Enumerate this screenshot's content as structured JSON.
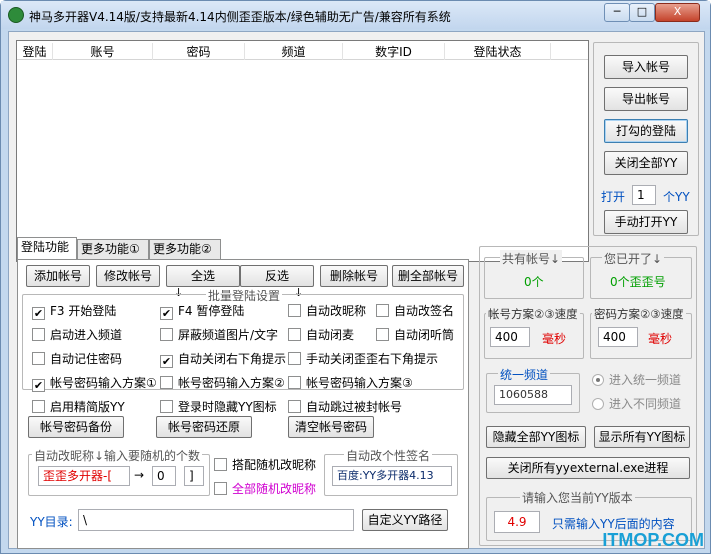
{
  "window": {
    "title": "神马多开器V4.14版/支持最新4.14内侧歪歪版本/绿色辅助无广告/兼容所有系统",
    "minimize": "─",
    "maximize": "□",
    "close": "X"
  },
  "account_list": {
    "columns": [
      "登陆",
      "账号",
      "密码",
      "频道",
      "数字ID",
      "登陆状态"
    ]
  },
  "right_panel": {
    "import": "导入帐号",
    "export": "导出帐号",
    "login_checked": "打勾的登陆",
    "close_all": "关闭全部YY",
    "open_prefix": "打开",
    "open_count": "1",
    "open_suffix": "个YY",
    "manual_open": "手动打开YY"
  },
  "tabs": [
    "登陆功能",
    "更多功能①",
    "更多功能②"
  ],
  "tab_panel": {
    "add": "添加帐号",
    "edit": "修改帐号",
    "select_all": "全选",
    "invert": "反选",
    "delete": "删除帐号",
    "delete_all": "删全部帐号",
    "batch_group": "批量登陆设置",
    "checks": [
      {
        "label": "F3 开始登陆",
        "checked": true
      },
      {
        "label": "F4 暂停登陆",
        "checked": true
      },
      {
        "label": "自动改昵称",
        "checked": false
      },
      {
        "label": "自动改签名",
        "checked": false
      },
      {
        "label": "启动进入频道",
        "checked": false
      },
      {
        "label": "屏蔽频道图片/文字",
        "checked": false
      },
      {
        "label": "自动闭麦",
        "checked": false
      },
      {
        "label": "自动闭听筒",
        "checked": false
      },
      {
        "label": "自动记住密码",
        "checked": false
      },
      {
        "label": "自动关闭右下角提示",
        "checked": true
      },
      {
        "label": "手动关闭歪歪右下角提示",
        "checked": false
      },
      {
        "label": "帐号密码输入方案①",
        "checked": true
      },
      {
        "label": "帐号密码输入方案②",
        "checked": false
      },
      {
        "label": "帐号密码输入方案③",
        "checked": false
      },
      {
        "label": "启用精简版YY",
        "checked": false
      },
      {
        "label": "登录时隐藏YY图标",
        "checked": false
      },
      {
        "label": "自动跳过被封帐号",
        "checked": false
      }
    ],
    "backup": "帐号密码备份",
    "restore": "帐号密码还原",
    "clear": "清空帐号密码",
    "nick_group": "自动改昵称↓输入要随机的个数",
    "nick_value": "歪歪多开器-[",
    "arrow": "→",
    "nick_count": "0",
    "nick_bracket": "]",
    "random_mix": "搭配随机改昵称",
    "all_random": "全部随机改昵称",
    "sign_group": "自动改个性签名",
    "sign_value": "百度:YY多开器4.13",
    "yy_dir_label": "YY目录:",
    "yy_dir_value": "\\",
    "custom_path": "自定义YY路径"
  },
  "stats": {
    "total_label": "共有帐号↓",
    "total_value": "0个",
    "opened_label": "您已开了↓",
    "opened_value": "0个歪歪号",
    "speed1_label": "帐号方案②③速度",
    "speed1_value": "400",
    "speed1_unit": "毫秒",
    "speed2_label": "密码方案②③速度",
    "speed2_value": "400",
    "speed2_unit": "毫秒",
    "channel_label": "统一频道",
    "channel_value": "1060588",
    "radio_unified": "进入统一频道",
    "radio_different": "进入不同频道",
    "hide_icons": "隐藏全部YY图标",
    "show_icons": "显示所有YY图标",
    "close_procs": "关闭所有yyexternal.exe进程",
    "version_label": "请输入您当前YY版本",
    "version_value": "4.9",
    "version_hint": "只需输入YY后面的内容"
  },
  "watermark": "ITMOP.COM",
  "colors": {
    "accent": "#c3d8ee",
    "red": "#e00000",
    "green": "#009f00",
    "blue": "#0050c0"
  }
}
